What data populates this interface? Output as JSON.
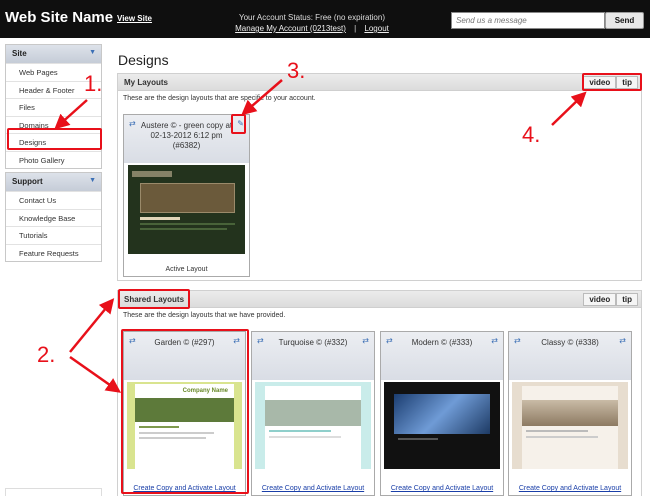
{
  "topbar": {
    "site_name": "Web Site Name",
    "view_site": "View Site",
    "account_status": "Your Account Status: Free (no expiration)",
    "manage_account": "Manage My Account (0213test)",
    "separator": "|",
    "logout": "Logout",
    "message_placeholder": "Send us a message",
    "send_label": "Send"
  },
  "sidebar": {
    "site_group": {
      "title": "Site",
      "items": [
        "Web Pages",
        "Header & Footer",
        "Files",
        "Domains",
        "Designs",
        "Photo Gallery"
      ],
      "active": "Designs"
    },
    "support_group": {
      "title": "Support",
      "items": [
        "Contact Us",
        "Knowledge Base",
        "Tutorials",
        "Feature Requests"
      ]
    }
  },
  "main": {
    "page_title": "Designs",
    "my_layouts": {
      "title": "My Layouts",
      "description": "These are the design layouts that are specific to your account.",
      "video_label": "video",
      "tip_label": "tip",
      "card": {
        "name": "Austere © - green copy at 02-13-2012 6:12 pm (#6382)",
        "footer": "Active Layout"
      }
    },
    "shared_layouts": {
      "title": "Shared Layouts",
      "description": "These are the design layouts that we have provided.",
      "video_label": "video",
      "tip_label": "tip",
      "cards": [
        {
          "name": "Garden © (#297)",
          "action": "Create Copy and Activate Layout",
          "thumb_title": "Company Name"
        },
        {
          "name": "Turquoise © (#332)",
          "action": "Create Copy and Activate Layout"
        },
        {
          "name": "Modern © (#333)",
          "action": "Create Copy and Activate Layout"
        },
        {
          "name": "Classy © (#338)",
          "action": "Create Copy and Activate Layout"
        }
      ]
    }
  },
  "callouts": [
    "1.",
    "2.",
    "3.",
    "4."
  ],
  "icons": {
    "link": "chain-link-icon",
    "edit": "pencil-icon",
    "chevron": "chevron-down-icon"
  },
  "colors": {
    "topbar": "#0f0f0f",
    "callout_red": "#e8101a",
    "link_blue": "#1a3fa8"
  }
}
